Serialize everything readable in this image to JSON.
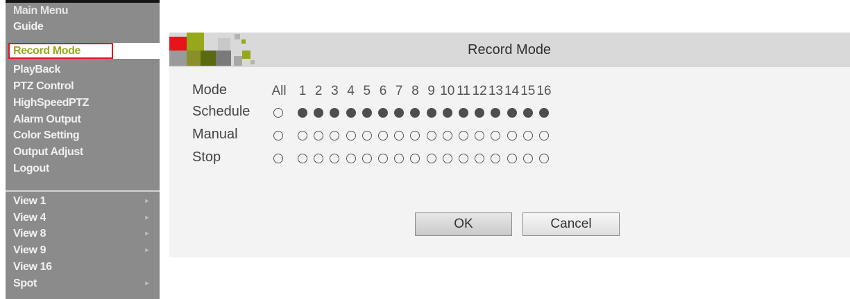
{
  "menu": {
    "items": [
      {
        "label": "Main Menu",
        "submenu": false,
        "selected": false,
        "title": true
      },
      {
        "label": "Guide",
        "submenu": false,
        "selected": false
      },
      {
        "label": "Record Mode",
        "submenu": false,
        "selected": true
      },
      {
        "label": "PlayBack",
        "submenu": false,
        "selected": false
      },
      {
        "label": "PTZ Control",
        "submenu": false,
        "selected": false
      },
      {
        "label": "HighSpeedPTZ",
        "submenu": false,
        "selected": false
      },
      {
        "label": "Alarm Output",
        "submenu": false,
        "selected": false
      },
      {
        "label": "Color Setting",
        "submenu": false,
        "selected": false
      },
      {
        "label": "Output Adjust",
        "submenu": false,
        "selected": false
      },
      {
        "label": "Logout",
        "submenu": false,
        "selected": false
      },
      {
        "label": "View 1",
        "submenu": true,
        "selected": false
      },
      {
        "label": "View 4",
        "submenu": true,
        "selected": false
      },
      {
        "label": "View 8",
        "submenu": true,
        "selected": false
      },
      {
        "label": "View 9",
        "submenu": true,
        "selected": false
      },
      {
        "label": "View 16",
        "submenu": false,
        "selected": false
      },
      {
        "label": "Spot",
        "submenu": true,
        "selected": false
      }
    ],
    "submenu_arrow": "▸",
    "colors": {
      "background": "#8b8b8b",
      "selected_text": "#97a71c",
      "selected_outline": "#e0141e"
    }
  },
  "dialog": {
    "title": "Record Mode",
    "mode_label": "Mode",
    "all_label": "All",
    "channels": [
      "1",
      "2",
      "3",
      "4",
      "5",
      "6",
      "7",
      "8",
      "9",
      "10",
      "11",
      "12",
      "13",
      "14",
      "15",
      "16"
    ],
    "rows": [
      {
        "label": "Schedule",
        "all": false,
        "channels": [
          true,
          true,
          true,
          true,
          true,
          true,
          true,
          true,
          true,
          true,
          true,
          true,
          true,
          true,
          true,
          true
        ]
      },
      {
        "label": "Manual",
        "all": false,
        "channels": [
          false,
          false,
          false,
          false,
          false,
          false,
          false,
          false,
          false,
          false,
          false,
          false,
          false,
          false,
          false,
          false
        ]
      },
      {
        "label": "Stop",
        "all": false,
        "channels": [
          false,
          false,
          false,
          false,
          false,
          false,
          false,
          false,
          false,
          false,
          false,
          false,
          false,
          false,
          false,
          false
        ]
      }
    ],
    "ok_label": "OK",
    "cancel_label": "Cancel",
    "logo_colors": [
      "#e8141c",
      "#97a71c",
      "#5a6a12",
      "#7a7a7a",
      "#a8a8a8"
    ]
  }
}
